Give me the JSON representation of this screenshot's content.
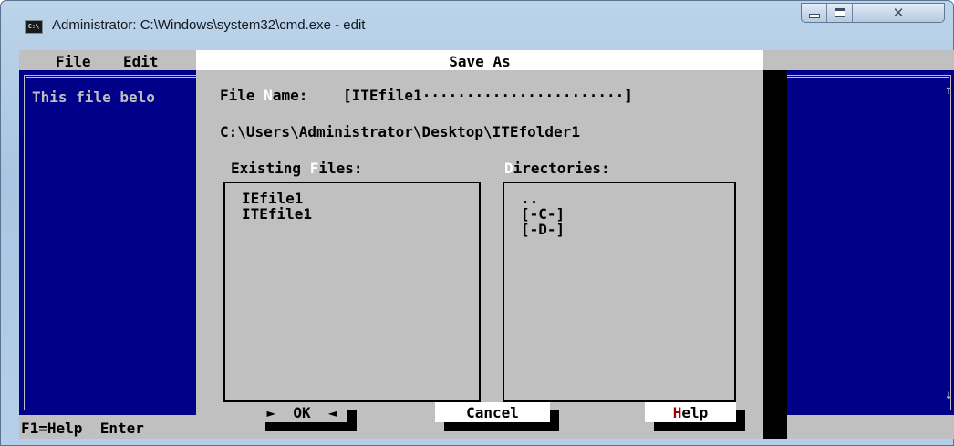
{
  "window": {
    "title": "Administrator: C:\\Windows\\system32\\cmd.exe - edit",
    "icon": "cmd-icon",
    "icon_text": "C:\\"
  },
  "menu": {
    "file": "File",
    "edit": "Edit"
  },
  "editor": {
    "visible_text": "This file belo"
  },
  "status": {
    "text": "F1=Help  Enter"
  },
  "dialog": {
    "title": "Save As",
    "file_name": {
      "label_pre": "File ",
      "label_hot": "N",
      "label_post": "ame:",
      "value": "[ITEfile1·······················]"
    },
    "current_path": "C:\\Users\\Administrator\\Desktop\\ITEfolder1",
    "files_label": {
      "pre": "Existing ",
      "hot": "F",
      "post": "iles:"
    },
    "dirs_label": {
      "hot": "D",
      "post": "irectories:"
    },
    "files": [
      "IEfile1",
      "ITEfile1"
    ],
    "directories": [
      "..",
      "[-C-]",
      "[-D-]"
    ],
    "buttons": {
      "ok": "OK",
      "ok_left_marker": "►",
      "ok_right_marker": "◄",
      "cancel": "Cancel",
      "help_hot": "H",
      "help_rest": "elp"
    }
  }
}
